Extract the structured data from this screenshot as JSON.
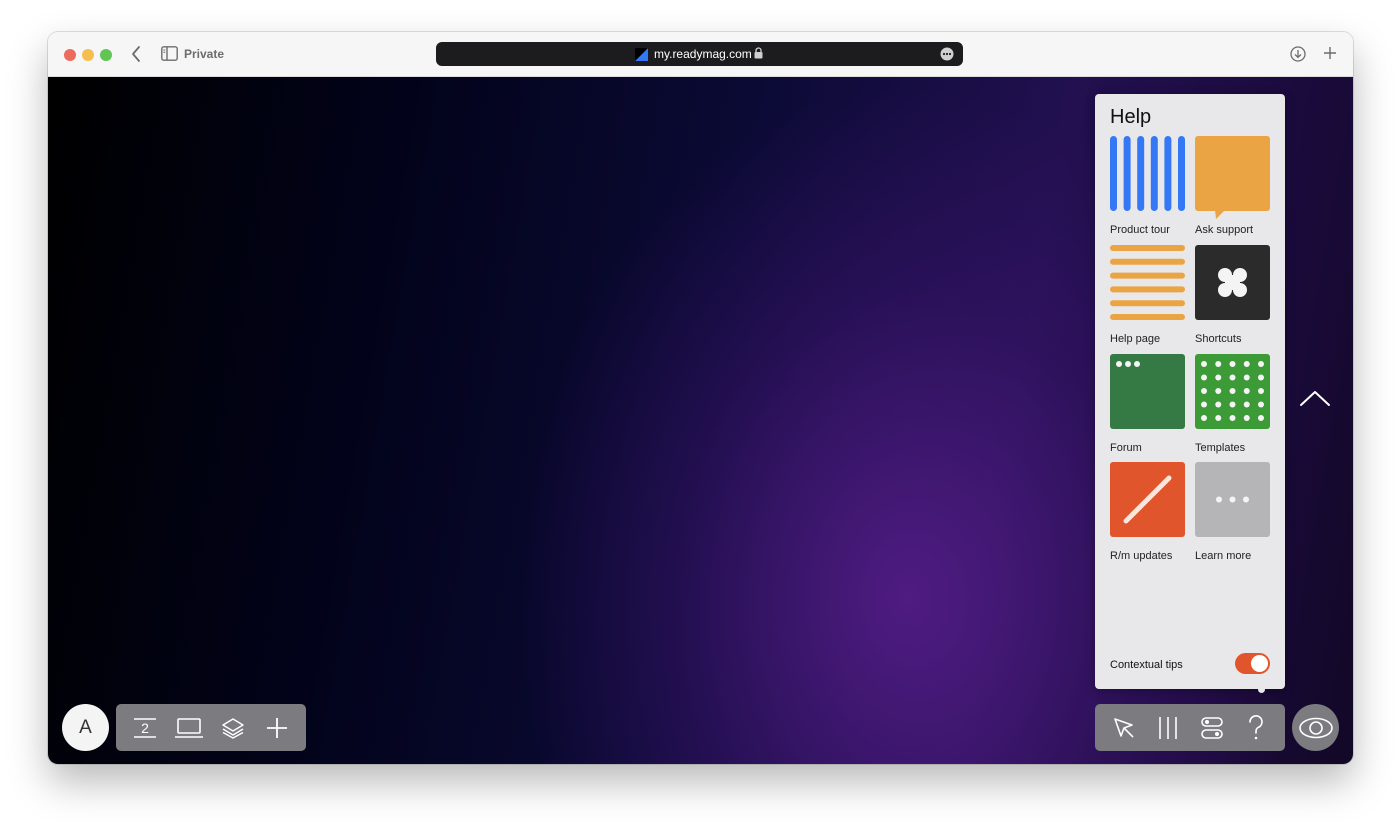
{
  "browser": {
    "private_label": "Private",
    "url": "my.readymag.com"
  },
  "toolbar_left": {
    "avatar_letter": "A",
    "pages_number": "2"
  },
  "help": {
    "title": "Help",
    "tiles": [
      {
        "label": "Product tour",
        "color": "#3478f6"
      },
      {
        "label": "Ask support",
        "color": "#eba443"
      },
      {
        "label": "Help page",
        "color": "#eba443"
      },
      {
        "label": "Shortcuts",
        "color": "#2b2b2b"
      },
      {
        "label": "Forum",
        "color": "#357a45"
      },
      {
        "label": "Templates",
        "color": "#3c9a37"
      },
      {
        "label": "R/m updates",
        "color": "#e0552b"
      },
      {
        "label": "Learn more",
        "color": "#b5b5b7"
      }
    ],
    "contextual_tips_label": "Contextual tips",
    "contextual_tips_enabled": true
  },
  "colors": {
    "accent": "#e0552b",
    "toolbar": "#7b7b80"
  }
}
